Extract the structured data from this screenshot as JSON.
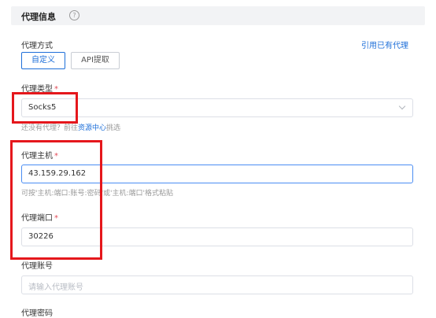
{
  "section": {
    "title": "代理信息",
    "help_icon": "?"
  },
  "proxy_method": {
    "label": "代理方式",
    "options": [
      "自定义",
      "API提取"
    ],
    "selected": "自定义",
    "reference_link": "引用已有代理"
  },
  "proxy_type": {
    "label": "代理类型",
    "required": "*",
    "value": "Socks5",
    "hint_prefix": "还没有代理？前往",
    "hint_link": "资源中心",
    "hint_suffix": "挑选"
  },
  "proxy_host": {
    "label": "代理主机",
    "required": "*",
    "value": "43.159.29.162",
    "hint": "可按'主机:端口:账号:密码'或'主机:端口'格式粘贴"
  },
  "proxy_port": {
    "label": "代理端口",
    "required": "*",
    "value": "30226"
  },
  "proxy_account": {
    "label": "代理账号",
    "placeholder": "请输入代理账号"
  },
  "proxy_password": {
    "label": "代理密码"
  },
  "colors": {
    "accent": "#1e6fd9",
    "annotation": "#e5171c",
    "required": "#e34d59"
  }
}
